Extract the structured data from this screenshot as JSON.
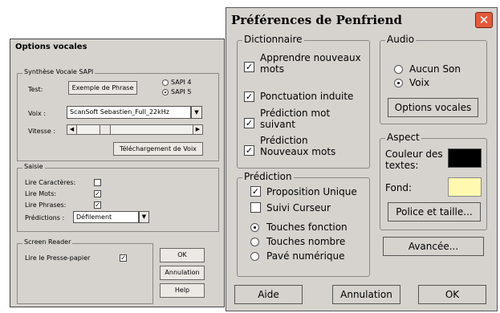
{
  "options_vocales": {
    "title": "Options vocales",
    "sapi": {
      "legend": "Synthèse Vocale SAPI",
      "test_label": "Test:",
      "test_button": "Exemple de Phrase",
      "sapi4": "SAPI 4",
      "sapi5": "SAPI 5",
      "sapi5_selected": true,
      "voix_label": "Voix :",
      "voix_value": "ScanSoft Sebastien_Full_22kHz",
      "vitesse_label": "Vitesse :",
      "download_button": "Téléchargement de Voix"
    },
    "saisie": {
      "legend": "Saisie",
      "items": [
        {
          "label": "Lire Caractères:",
          "checked": false
        },
        {
          "label": "Lire Mots:",
          "checked": true
        },
        {
          "label": "Lire Phrases:",
          "checked": true
        }
      ],
      "predictions_label": "Prédictions :",
      "predictions_value": "Défilement"
    },
    "screen_reader": {
      "legend": "Screen Reader",
      "clipboard_label": "Lire le Presse-papier",
      "clipboard_checked": true
    },
    "buttons": {
      "ok": "OK",
      "cancel": "Annulation",
      "help": "Help"
    }
  },
  "penfriend": {
    "title": "Préférences de Penfriend",
    "dictionnaire": {
      "legend": "Dictionnaire",
      "items": [
        {
          "label": "Apprendre nouveaux mots",
          "checked": true
        },
        {
          "label": "Ponctuation induite",
          "checked": true
        },
        {
          "label": "Prédiction mot suivant",
          "checked": true
        },
        {
          "label": "Prédiction Nouveaux mots",
          "checked": true
        }
      ]
    },
    "prediction": {
      "legend": "Prédiction",
      "proposition_unique": "Proposition Unique",
      "proposition_checked": true,
      "suivi_curseur": "Suivi Curseur",
      "suivi_checked": false,
      "radios": [
        {
          "label": "Touches fonction",
          "selected": true
        },
        {
          "label": "Touches nombre",
          "selected": false
        },
        {
          "label": "Pavé numérique",
          "selected": false
        }
      ]
    },
    "audio": {
      "legend": "Audio",
      "aucun_son": "Aucun Son",
      "voix": "Voix",
      "voix_selected": true,
      "options_button": "Options vocales"
    },
    "aspect": {
      "legend": "Aspect",
      "text_color_label": "Couleur des textes:",
      "text_color": "#000000",
      "bg_label": "Fond:",
      "bg_color": "#fff9b0",
      "font_button": "Police et taille..."
    },
    "advanced_button": "Avancée...",
    "bottom": {
      "help": "Aide",
      "cancel": "Annulation",
      "ok": "OK"
    }
  }
}
